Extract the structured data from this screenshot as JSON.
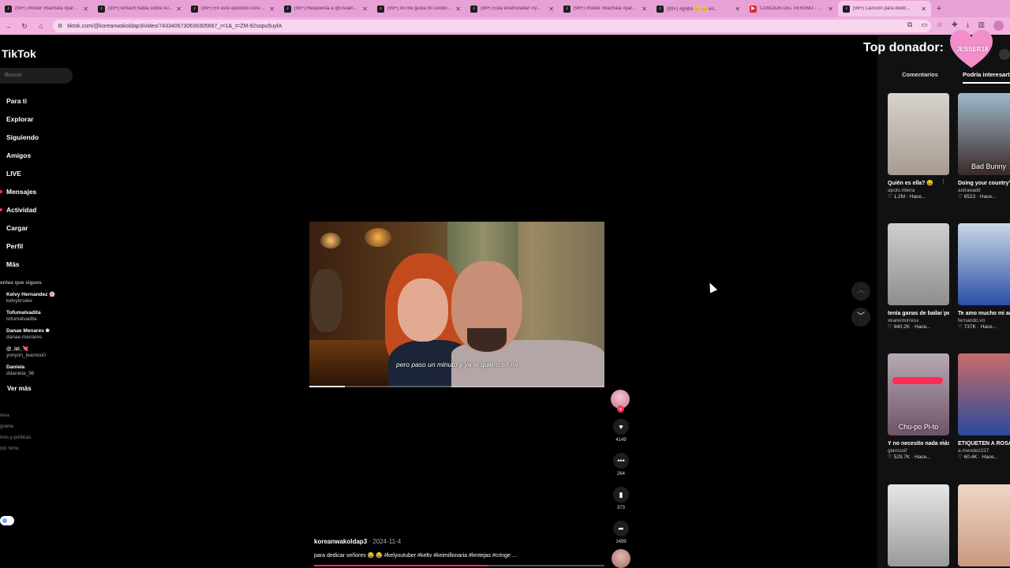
{
  "browser": {
    "tabs": [
      {
        "title": "(99+) #foster #bachata #parq...",
        "icon": "tiktok-icon"
      },
      {
        "title": "(99+) lemách habla sobre Au...",
        "icon": "tiktok-icon"
      },
      {
        "title": "(99+) En este episodio conve...",
        "icon": "tiktok-icon"
      },
      {
        "title": "(99+) Respuesta a @Usuario...",
        "icon": "tiktok-icon"
      },
      {
        "title": "(99+) no me gusta mi condició...",
        "icon": "tiktok-icon"
      },
      {
        "title": "(99+) Esta enamorada!! #y...",
        "icon": "tiktok-icon"
      },
      {
        "title": "(99+) #foster #bachata #parq...",
        "icon": "tiktok-icon"
      },
      {
        "title": "(99+) #ghibli 😊 😊 en...",
        "icon": "tiktok-icon"
      },
      {
        "title": "CANCIÓN DEL VERANO - Yo...",
        "icon": "youtube-icon"
      },
      {
        "title": "(99+) Canción para dedic...",
        "icon": "tiktok-icon",
        "active": true
      }
    ],
    "url": "tiktok.com/@koreanwakoldap3/video/7433406730639305667_r=1&_t=ZM-92sopu5uyfA"
  },
  "sidebar": {
    "logo": "TikTok",
    "search_placeholder": "Buscar",
    "nav": [
      {
        "label": "Para ti",
        "dot": false
      },
      {
        "label": "Explorar",
        "dot": false
      },
      {
        "label": "Siguiendo",
        "dot": false
      },
      {
        "label": "Amigos",
        "dot": false
      },
      {
        "label": "LIVE",
        "dot": false
      },
      {
        "label": "Mensajes",
        "dot": true
      },
      {
        "label": "Actividad",
        "dot": true
      },
      {
        "label": "Cargar",
        "dot": false
      },
      {
        "label": "Perfil",
        "dot": false
      },
      {
        "label": "Más",
        "dot": false
      }
    ],
    "following_heading": "entas que sigues",
    "following": [
      {
        "name": "Kelvy Hernandez 🌸",
        "handle": "kelvybrulee"
      },
      {
        "name": "Tofumalvadita",
        "handle": "tofumalvadita"
      },
      {
        "name": "Danae Menares ❀",
        "handle": "danae.menares"
      },
      {
        "name": "@_izi_💘",
        "handle": "yonyon_teamoo0"
      },
      {
        "name": "Daniela",
        "handle": "ddaniela_96"
      }
    ],
    "see_more": "Ver más",
    "footer": [
      "resa",
      "grama",
      "inos y políticas"
    ],
    "copyright": "026 TikTok"
  },
  "video": {
    "subtitle": "pero paso un minuto y ya te quiero en mi",
    "progress": 0.12,
    "author": "koreanwakoldap3",
    "date": "2024-11-4",
    "caption": "para dedicar señores 😂 😂 #kelyoutuber #keltv #keimillonaria #lentejas #cringe ..."
  },
  "actions": {
    "likes": "4149",
    "comments": "264",
    "saves": "373",
    "shares": "1499"
  },
  "right_panel": {
    "top_donor_label": "Top donador:",
    "donor_name": "JESSER18",
    "tabs": [
      "Comentarios",
      "Podría interesarte"
    ],
    "cards": [
      {
        "title": "Quién es ella? 😄",
        "user": "apolo.ribera",
        "stats": "♡ 1.2M · Hace...",
        "overlay": ""
      },
      {
        "title": "Doing your country's most...",
        "user": "astraeadtl",
        "stats": "♡ 6523 · Hace...",
        "overlay": "Bad Bunny"
      },
      {
        "title": "tenía ganas de bailar pero lo...",
        "user": "xkarentorresx",
        "stats": "♡ 940.2K · Hace...",
        "overlay": ""
      },
      {
        "title": "Te amo mucho mi amor #couple @...",
        "user": "fernando.vo",
        "stats": "♡ 737K · Hace...",
        "overlay": ""
      },
      {
        "title": "Y no necesito nada más 😍 😂 ...",
        "user": "giarossif",
        "stats": "♡ 529.7K · Hace...",
        "overlay": "Chu-po Pi-to"
      },
      {
        "title": "ETIQUETEN A ROSALÍA, la...",
        "user": "a.mendez237",
        "stats": "♡ 60.4K · Hace...",
        "overlay": ""
      },
      {
        "title": "",
        "user": "",
        "stats": "",
        "overlay": ""
      },
      {
        "title": "",
        "user": "",
        "stats": "",
        "overlay": ""
      }
    ]
  },
  "colors": {
    "accent": "#fe2c55",
    "browser_chrome": "#e7a1d6",
    "background": "#000000"
  }
}
